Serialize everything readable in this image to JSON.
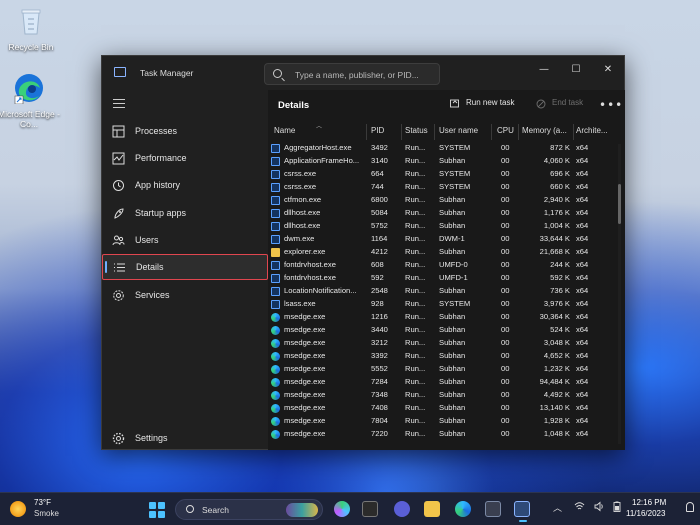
{
  "desktop": {
    "icons": [
      {
        "label": "Recycle Bin"
      },
      {
        "label": "Microsoft Edge - Co..."
      }
    ]
  },
  "window": {
    "title": "Task Manager",
    "search_placeholder": "Type a name, publisher, or PID...",
    "controls": {
      "minimize": "—",
      "maximize": "☐",
      "close": "✕"
    }
  },
  "sidebar": {
    "items": [
      {
        "label": "Processes"
      },
      {
        "label": "Performance"
      },
      {
        "label": "App history"
      },
      {
        "label": "Startup apps"
      },
      {
        "label": "Users"
      },
      {
        "label": "Details"
      },
      {
        "label": "Services"
      }
    ],
    "settings_label": "Settings",
    "active": "Details"
  },
  "main": {
    "title": "Details",
    "toolbar": {
      "run_new_task": "Run new task",
      "end_task": "End task",
      "more": "•••"
    },
    "columns": [
      "Name",
      "PID",
      "Status",
      "User name",
      "CPU",
      "Memory (a...",
      "Archite..."
    ],
    "rows": [
      {
        "icon": "box",
        "name": "AggregatorHost.exe",
        "pid": "3492",
        "status": "Run...",
        "user": "SYSTEM",
        "cpu": "00",
        "mem": "872 K",
        "arch": "x64"
      },
      {
        "icon": "box",
        "name": "ApplicationFrameHo...",
        "pid": "3140",
        "status": "Run...",
        "user": "Subhan",
        "cpu": "00",
        "mem": "4,060 K",
        "arch": "x64"
      },
      {
        "icon": "box",
        "name": "csrss.exe",
        "pid": "664",
        "status": "Run...",
        "user": "SYSTEM",
        "cpu": "00",
        "mem": "696 K",
        "arch": "x64"
      },
      {
        "icon": "box",
        "name": "csrss.exe",
        "pid": "744",
        "status": "Run...",
        "user": "SYSTEM",
        "cpu": "00",
        "mem": "660 K",
        "arch": "x64"
      },
      {
        "icon": "box",
        "name": "ctfmon.exe",
        "pid": "6800",
        "status": "Run...",
        "user": "Subhan",
        "cpu": "00",
        "mem": "2,940 K",
        "arch": "x64"
      },
      {
        "icon": "box",
        "name": "dllhost.exe",
        "pid": "5084",
        "status": "Run...",
        "user": "Subhan",
        "cpu": "00",
        "mem": "1,176 K",
        "arch": "x64"
      },
      {
        "icon": "box",
        "name": "dllhost.exe",
        "pid": "5752",
        "status": "Run...",
        "user": "Subhan",
        "cpu": "00",
        "mem": "1,004 K",
        "arch": "x64"
      },
      {
        "icon": "box",
        "name": "dwm.exe",
        "pid": "1164",
        "status": "Run...",
        "user": "DWM-1",
        "cpu": "00",
        "mem": "33,644 K",
        "arch": "x64"
      },
      {
        "icon": "folder",
        "name": "explorer.exe",
        "pid": "4212",
        "status": "Run...",
        "user": "Subhan",
        "cpu": "00",
        "mem": "21,668 K",
        "arch": "x64"
      },
      {
        "icon": "box",
        "name": "fontdrvhost.exe",
        "pid": "608",
        "status": "Run...",
        "user": "UMFD-0",
        "cpu": "00",
        "mem": "244 K",
        "arch": "x64"
      },
      {
        "icon": "box",
        "name": "fontdrvhost.exe",
        "pid": "592",
        "status": "Run...",
        "user": "UMFD-1",
        "cpu": "00",
        "mem": "592 K",
        "arch": "x64"
      },
      {
        "icon": "box",
        "name": "LocationNotification...",
        "pid": "2548",
        "status": "Run...",
        "user": "Subhan",
        "cpu": "00",
        "mem": "736 K",
        "arch": "x64"
      },
      {
        "icon": "box",
        "name": "lsass.exe",
        "pid": "928",
        "status": "Run...",
        "user": "SYSTEM",
        "cpu": "00",
        "mem": "3,976 K",
        "arch": "x64"
      },
      {
        "icon": "edge",
        "name": "msedge.exe",
        "pid": "1216",
        "status": "Run...",
        "user": "Subhan",
        "cpu": "00",
        "mem": "30,364 K",
        "arch": "x64"
      },
      {
        "icon": "edge",
        "name": "msedge.exe",
        "pid": "3440",
        "status": "Run...",
        "user": "Subhan",
        "cpu": "00",
        "mem": "524 K",
        "arch": "x64"
      },
      {
        "icon": "edge",
        "name": "msedge.exe",
        "pid": "3212",
        "status": "Run...",
        "user": "Subhan",
        "cpu": "00",
        "mem": "3,048 K",
        "arch": "x64"
      },
      {
        "icon": "edge",
        "name": "msedge.exe",
        "pid": "3392",
        "status": "Run...",
        "user": "Subhan",
        "cpu": "00",
        "mem": "4,652 K",
        "arch": "x64"
      },
      {
        "icon": "edge",
        "name": "msedge.exe",
        "pid": "5552",
        "status": "Run...",
        "user": "Subhan",
        "cpu": "00",
        "mem": "1,232 K",
        "arch": "x64"
      },
      {
        "icon": "edge",
        "name": "msedge.exe",
        "pid": "7284",
        "status": "Run...",
        "user": "Subhan",
        "cpu": "00",
        "mem": "94,484 K",
        "arch": "x64"
      },
      {
        "icon": "edge",
        "name": "msedge.exe",
        "pid": "7348",
        "status": "Run...",
        "user": "Subhan",
        "cpu": "00",
        "mem": "4,492 K",
        "arch": "x64"
      },
      {
        "icon": "edge",
        "name": "msedge.exe",
        "pid": "7408",
        "status": "Run...",
        "user": "Subhan",
        "cpu": "00",
        "mem": "13,140 K",
        "arch": "x64"
      },
      {
        "icon": "edge",
        "name": "msedge.exe",
        "pid": "7804",
        "status": "Run...",
        "user": "Subhan",
        "cpu": "00",
        "mem": "1,928 K",
        "arch": "x64"
      },
      {
        "icon": "edge",
        "name": "msedge.exe",
        "pid": "7220",
        "status": "Run...",
        "user": "Subhan",
        "cpu": "00",
        "mem": "1,048 K",
        "arch": "x64"
      }
    ]
  },
  "taskbar": {
    "weather": {
      "temp": "73°F",
      "condition": "Smoke"
    },
    "search_label": "Search",
    "clock": {
      "time": "12:16 PM",
      "date": "11/16/2023"
    }
  },
  "colors": {
    "accent": "#4cc2ff",
    "highlight_border": "#e0464f",
    "window_bg": "#202020"
  }
}
